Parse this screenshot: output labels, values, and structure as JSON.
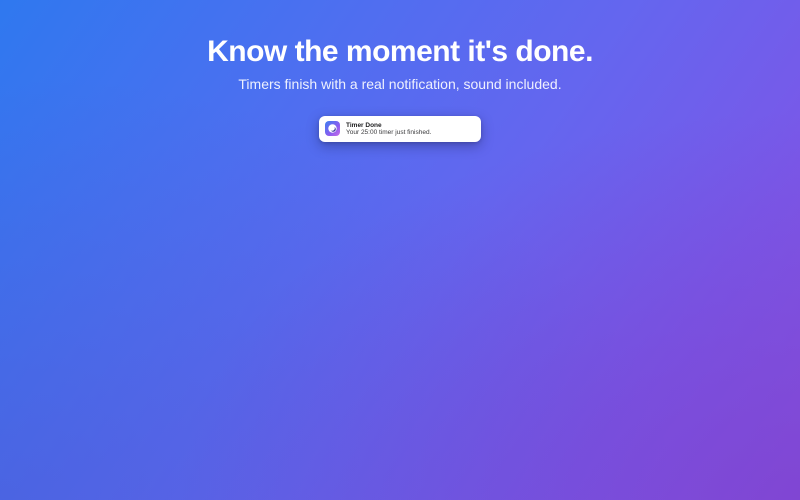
{
  "hero": {
    "headline": "Know the moment it's done.",
    "subheadline": "Timers finish with a real notification, sound included."
  },
  "notification": {
    "app_icon": "timer-app-icon",
    "title": "Timer Done",
    "body": "Your 25:00 timer just finished."
  },
  "colors": {
    "background_start": "#2f78ef",
    "background_end": "#8a52e0",
    "text": "#ffffff",
    "notification_bg": "#ffffff"
  }
}
